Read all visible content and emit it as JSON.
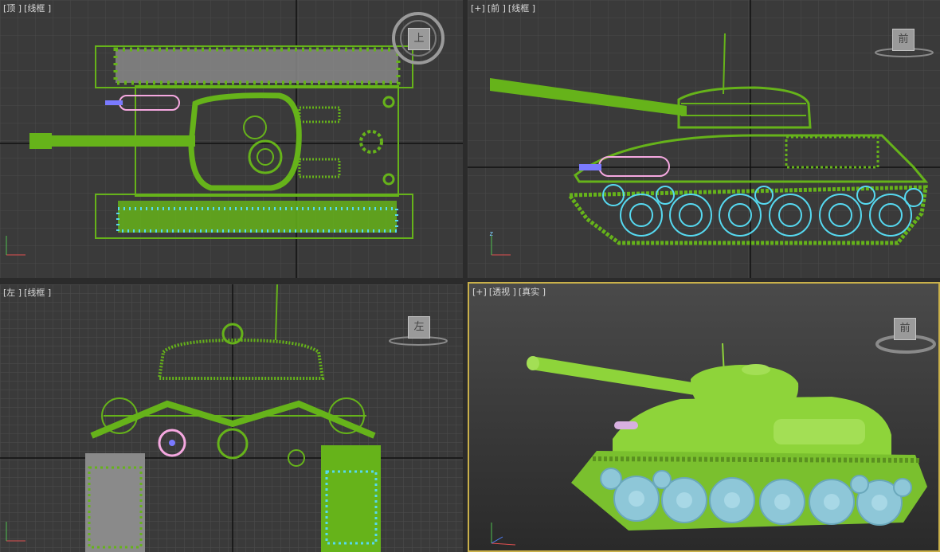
{
  "viewports": {
    "top": {
      "label_parts": [
        "[顶 ]",
        "[线框 ]"
      ],
      "cube": "上"
    },
    "front": {
      "label_parts": [
        "[+]",
        "[前 ]",
        "[线框 ]"
      ],
      "cube": "前"
    },
    "left": {
      "label_parts": [
        "[左 ]",
        "[线框 ]"
      ],
      "cube": "左"
    },
    "perspective": {
      "label_parts": [
        "[+]",
        "[透视 ]",
        "[真实 ]"
      ],
      "cube": "前"
    }
  },
  "axis_letters": {
    "z": "z",
    "x": "x",
    "y": "y"
  },
  "colors": {
    "background_dark": "#3a3a3a",
    "grid_line": "#4a4a4a",
    "grid_major": "#1a1a1a",
    "wire_green": "#66b31a",
    "wheel_cyan": "#56d9f0",
    "barrel_pink": "#f5a8e0",
    "track_gray": "#8a8a8a",
    "solid_green": "#8ed43a",
    "active_border": "#c9b04a"
  },
  "icons": [
    "viewcube-icon",
    "steering-wheel-icon",
    "axis-tripod-icon"
  ]
}
